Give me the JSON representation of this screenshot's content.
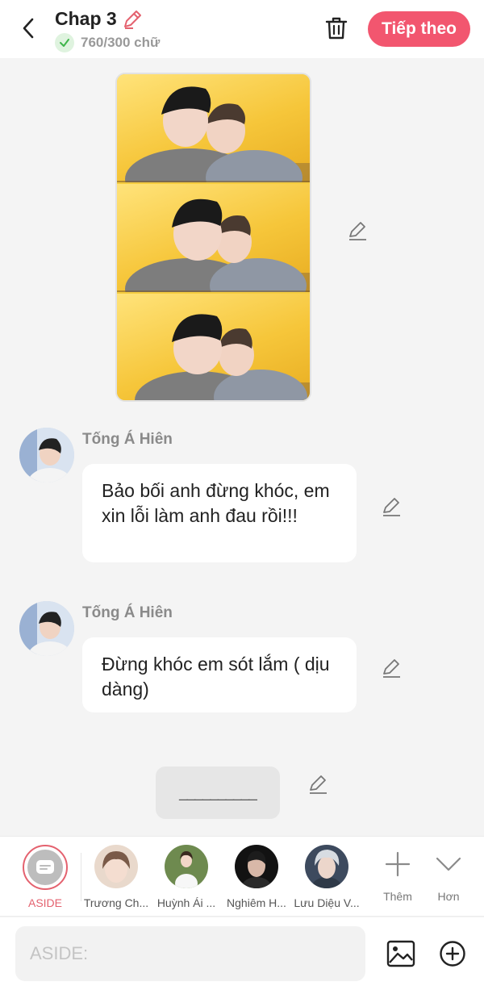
{
  "header": {
    "title": "Chap 3",
    "word_count": "760/300 chữ",
    "next_label": "Tiếp theo"
  },
  "messages": [
    {
      "character": "Tống Á Hiên",
      "text": "Bảo bối anh đừng khóc, em xin lỗi làm anh đau rồi!!!"
    },
    {
      "character": "Tống Á Hiên",
      "text": "Đừng khóc em sót lắm ( dịu dàng)"
    }
  ],
  "aside_message": {
    "text": "__________"
  },
  "character_bar": {
    "items": [
      {
        "label": "ASIDE",
        "selected": true
      },
      {
        "label": "Trương Ch..."
      },
      {
        "label": "Huỳnh Ái ..."
      },
      {
        "label": "Nghiêm H..."
      },
      {
        "label": "Lưu Diệu V..."
      }
    ],
    "more_label": "Thêm",
    "expand_label": "Hơn"
  },
  "composer": {
    "placeholder": "ASIDE:"
  },
  "colors": {
    "accent": "#f2566f",
    "aside_ring": "#e4626f",
    "check_green": "#3fb54b"
  },
  "icons": {
    "back": "chevron-left-icon",
    "title_edit": "pencil-icon",
    "check": "check-icon",
    "trash": "trash-icon",
    "edit": "pencil-icon",
    "aside": "speech-bubble-icon",
    "more": "plus-icon",
    "expand": "chevron-down-icon",
    "image": "image-icon",
    "add": "plus-circle-icon"
  }
}
